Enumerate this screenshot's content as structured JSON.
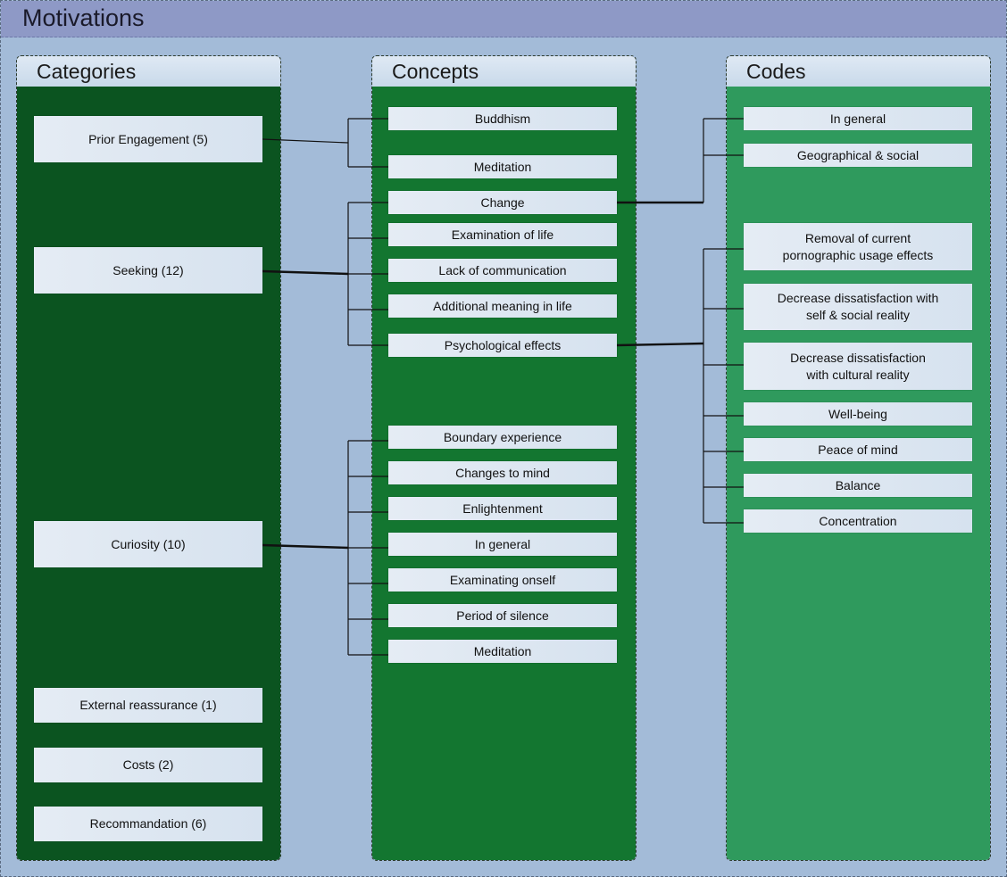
{
  "title": "Motivations",
  "lanes": {
    "categories": "Categories",
    "concepts": "Concepts",
    "codes": "Codes"
  },
  "categories": [
    "Prior Engagement (5)",
    "Seeking (12)",
    "Curiosity (10)",
    "External reassurance (1)",
    "Costs (2)",
    "Recommandation (6)"
  ],
  "concepts": [
    "Buddhism",
    "Meditation",
    "Change",
    "Examination of life",
    "Lack of communication",
    "Additional meaning in life",
    "Psychological effects",
    "Boundary experience",
    "Changes to mind",
    "Enlightenment",
    "In general",
    "Examinating onself",
    "Period of silence",
    "Meditation"
  ],
  "codes": [
    "In general",
    "Geographical & social",
    "Removal of current\npornographic usage effects",
    "Decrease dissatisfaction with\nself & social reality",
    "Decrease dissatisfaction\nwith cultural reality",
    "Well-being",
    "Peace of mind",
    "Balance",
    "Concentration"
  ],
  "colors": {
    "background": "#a3bbd8",
    "title_bar": "#8e99c6",
    "categories_lane": "#0b5420",
    "concepts_lane": "#137630",
    "codes_lane": "#2f9a5d",
    "box": "#dde7f2",
    "connector": "#111111"
  }
}
